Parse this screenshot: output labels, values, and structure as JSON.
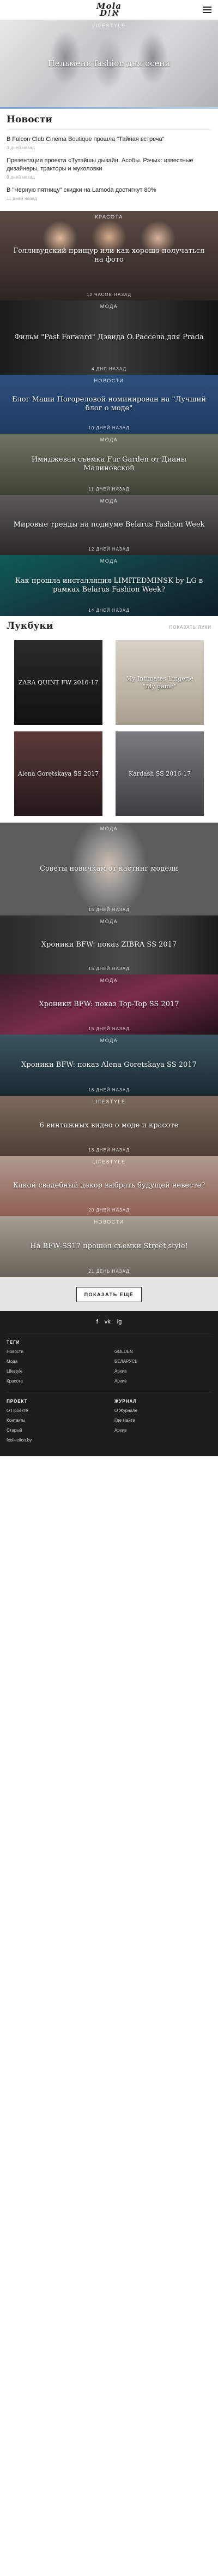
{
  "header": {
    "logo_line1": "Mola",
    "logo_line2": "Ⅾ!ℵ"
  },
  "hero": {
    "category": "LIFESTYLE",
    "title": "Пельмени fashion дня осени"
  },
  "news": {
    "title": "Новости",
    "items": [
      {
        "text": "В Falcon Club Cinema Boutique прошла \"Тайная встреча\"",
        "date": "3 дней назад"
      },
      {
        "text": "Презентация проекта «Тутэйшы дызайн. Асобы. Рэчы»: известные дизайнеры, тракторы и мухоловки",
        "date": "8 дней назад"
      },
      {
        "text": "В \"Черную пятницу\" скидки на Lamoda достигнут 80%",
        "date": "11 дней назад"
      }
    ]
  },
  "cards_1": [
    {
      "category": "КРАСОТА",
      "title": "Голливудский прищур или как хорошо получаться на фото",
      "date": "12 ЧАСОВ НАЗАД"
    },
    {
      "category": "МОДА",
      "title": "Фильм \"Past Forward\" Дэвида О.Рассела для Prada",
      "date": "4 ДНЯ НАЗАД"
    },
    {
      "category": "НОВОСТИ",
      "title": "Блог Маши Погореловой номинирован на \"Лучший блог о моде\"",
      "date": "10 ДНЕЙ НАЗАД"
    },
    {
      "category": "МОДА",
      "title": "Имиджевая съемка Fur Garden от Дианы Малиновской",
      "date": "11 ДНЕЙ НАЗАД"
    },
    {
      "category": "МОДА",
      "title": "Мировые тренды на подиуме Belarus Fashion Week",
      "date": "12 ДНЕЙ НАЗАД"
    },
    {
      "category": "МОДА",
      "title": "Как прошла инсталляция LIMITEDMINSK by LG в рамках Belarus Fashion Week?",
      "date": "14 ДНЕЙ НАЗАД"
    }
  ],
  "lookbook": {
    "title": "Лукбуки",
    "more": "ПОКАЗАТЬ ЛУКИ",
    "items": [
      {
        "title": "ZARA QUINT FW 2016-17"
      },
      {
        "title": "My Intimates Lingerie \"My game\""
      },
      {
        "title": "Alena Goretskaya SS 2017"
      },
      {
        "title": "Kardash SS 2016-17"
      }
    ]
  },
  "cards_2": [
    {
      "category": "МОДА",
      "title": "Советы новичкам от кастинг модели",
      "date": "15 ДНЕЙ НАЗАД"
    },
    {
      "category": "МОДА",
      "title": "Хроники BFW: показ ZIBRA SS 2017",
      "date": "15 ДНЕЙ НАЗАД"
    },
    {
      "category": "МОДА",
      "title": "Хроники BFW: показ Top-Top SS 2017",
      "date": "15 ДНЕЙ НАЗАД"
    },
    {
      "category": "МОДА",
      "title": "Хроники BFW: показ Alena Goretskaya SS 2017",
      "date": "16 ДНЕЙ НАЗАД"
    },
    {
      "category": "LIFESTYLE",
      "title": "6 винтажных видео о моде и красоте",
      "date": "18 ДНЕЙ НАЗАД"
    },
    {
      "category": "LIFESTYLE",
      "title": "Какой свадебный декор выбрать будущей невесте?",
      "date": "20 ДНЕЙ НАЗАД"
    },
    {
      "category": "НОВОСТИ",
      "title": "На BFW-SS17 прошел съемки Street style!",
      "date": "21 ДЕНЬ НАЗАД"
    }
  ],
  "show_more": "ПОКАЗАТЬ ЕЩЁ",
  "footer": {
    "socials": [
      "f",
      "vk",
      "ig"
    ],
    "tags_title": "ТЕГИ",
    "tags_left": [
      "Новости",
      "Мода",
      "Lifestyle",
      "Красота"
    ],
    "tags_right": [
      "GOLDEN",
      "БЕЛАРУСЬ",
      "Архив",
      "Архив"
    ],
    "project_title": "ПРОЕКТ",
    "project_links": [
      "О Проекте",
      "Контакты",
      "Старый",
      "fcollection.by"
    ],
    "journal_title": "ЖУРНАЛ",
    "journal_links": [
      "О Журнале",
      "Где Найти",
      "Архив"
    ]
  }
}
